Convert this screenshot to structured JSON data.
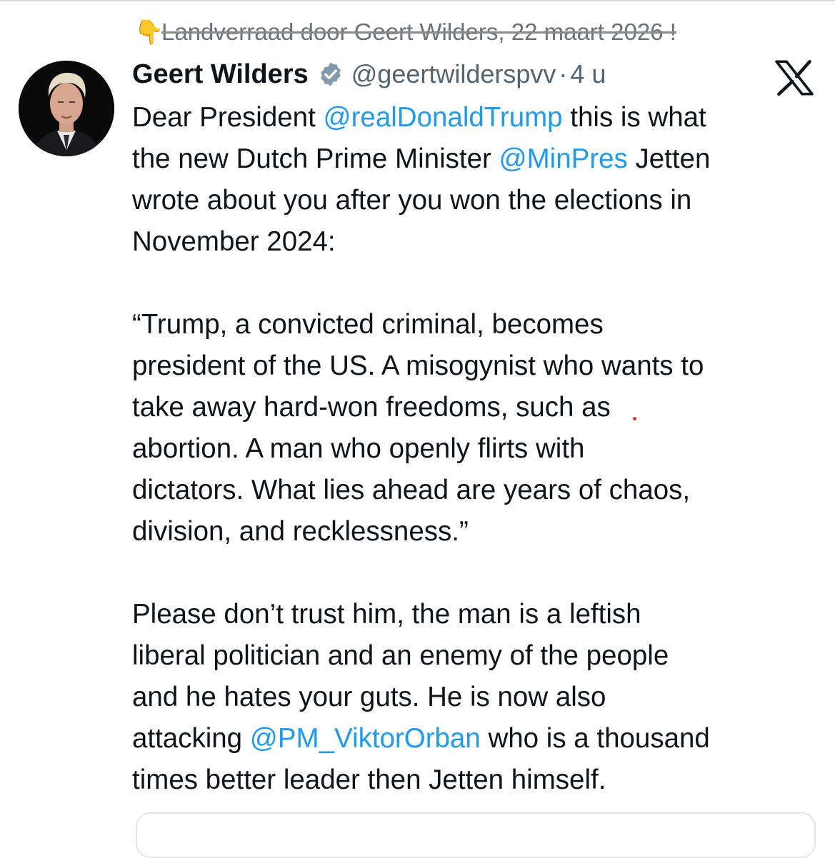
{
  "overlay": {
    "caption_emoji": "👇",
    "caption": "Landverraad door Geert Wilders, 22 maart 2026 !"
  },
  "tweet": {
    "author_name": "Geert Wilders",
    "handle": "@geertwilderspvv",
    "separator": "·",
    "time": "4 u",
    "body": {
      "l1a": "Dear President ",
      "l1m": "@realDonaldTrump",
      "l1b": " this is what",
      "l2a": "the new Dutch Prime Minister ",
      "l2m": "@MinPres",
      "l2b": " Jetten",
      "l3": "wrote about you after you won the elections in",
      "l4": "November 2024:",
      "q1": "“Trump, a convicted criminal, becomes",
      "q2": "president of the US. A misogynist who wants to",
      "q3": "take away hard-won freedoms, such as",
      "q4": "abortion. A man who openly flirts with",
      "q5": "dictators. What lies ahead are years of chaos,",
      "q6": "division, and recklessness.”",
      "p1": "Please don’t trust him, the man is a leftish",
      "p2": "liberal politician and an enemy of the people",
      "p3": "and he hates your guts. He is now also",
      "p4a": "attacking ",
      "p4m": "@PM_ViktorOrban",
      "p4b": " who is a thousand",
      "p5": "times better leader then Jetten himself."
    }
  },
  "icons": {
    "verified": "verified-badge-icon",
    "platform": "x-logo-icon",
    "hand": "hand-pointing-down-icon"
  },
  "colors": {
    "mention": "#1d9bf0",
    "muted": "#536471",
    "text": "#0f1419",
    "badge": "#829aab"
  }
}
